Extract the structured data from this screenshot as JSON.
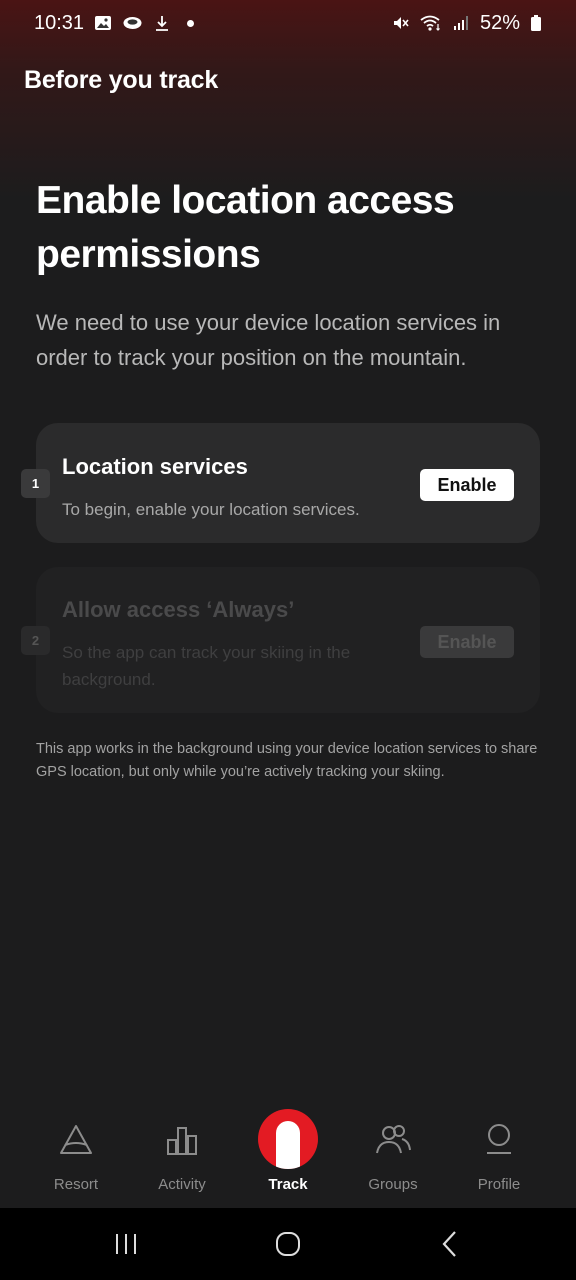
{
  "status_bar": {
    "time": "10:31",
    "battery": "52%",
    "icons": [
      "gallery-icon",
      "notification-icon",
      "download-icon",
      "dot-icon",
      "mute-icon",
      "wifi-icon",
      "signal-icon",
      "battery-icon"
    ]
  },
  "header": {
    "title": "Before you track"
  },
  "main": {
    "headline": "Enable location access permissions",
    "description": "We need to use your device location services in order to track your position on the mountain.",
    "steps": [
      {
        "number": "1",
        "title": "Location services",
        "description": "To begin, enable your location services.",
        "button_label": "Enable",
        "enabled": true
      },
      {
        "number": "2",
        "title": "Allow access ‘Always’",
        "description": "So the app can track your skiing in the background.",
        "button_label": "Enable",
        "enabled": false
      }
    ],
    "footnote": "This app works in the background using your device location services to share GPS location, but only while you’re actively tracking your skiing."
  },
  "tab_bar": {
    "tabs": [
      {
        "label": "Resort",
        "icon": "resort-icon"
      },
      {
        "label": "Activity",
        "icon": "activity-icon"
      },
      {
        "label": "Track",
        "icon": "track-icon",
        "active": true
      },
      {
        "label": "Groups",
        "icon": "groups-icon"
      },
      {
        "label": "Profile",
        "icon": "profile-icon"
      }
    ]
  },
  "system_nav": {
    "icons": [
      "recent-apps-icon",
      "home-icon",
      "back-icon"
    ]
  },
  "colors": {
    "accent": "#e31b23",
    "background": "#1c1c1d",
    "card": "#2b2b2c"
  }
}
